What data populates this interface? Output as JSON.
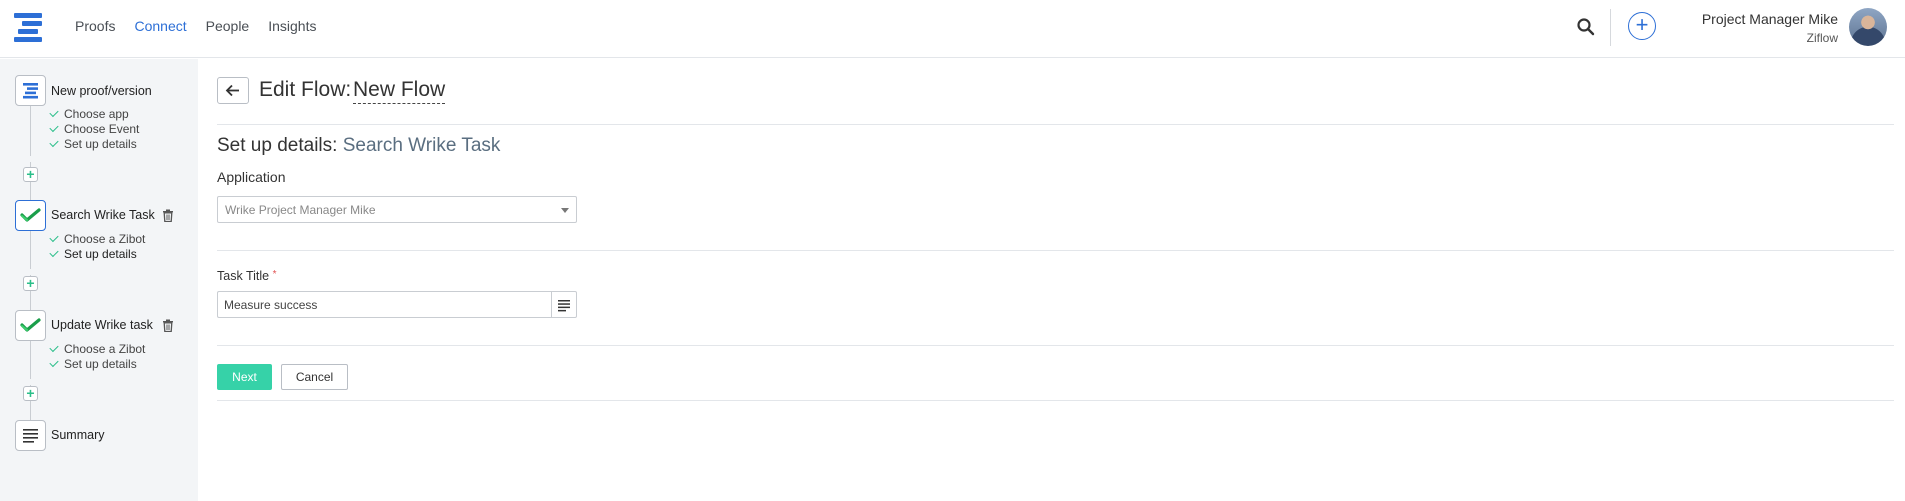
{
  "nav": {
    "items": [
      {
        "label": "Proofs"
      },
      {
        "label": "Connect",
        "active": true
      },
      {
        "label": "People"
      },
      {
        "label": "Insights"
      }
    ]
  },
  "header": {
    "search_icon": "search-icon",
    "add_icon": "plus-circle-icon",
    "user_name": "Project Manager Mike",
    "user_org": "Ziflow"
  },
  "sidebar": {
    "steps": [
      {
        "title": "New proof/version",
        "icon": "ziflow-logo-icon",
        "subs": [
          "Choose app",
          "Choose Event",
          "Set up details"
        ]
      },
      {
        "title": "Search Wrike Task",
        "icon": "wrike-check-icon",
        "subs": [
          "Choose a Zibot",
          "Set up details"
        ],
        "active": true
      },
      {
        "title": "Update Wrike task",
        "icon": "wrike-check-icon",
        "subs": [
          "Choose a Zibot",
          "Set up details"
        ]
      },
      {
        "title": "Summary",
        "icon": "list-lines-icon"
      }
    ]
  },
  "main": {
    "edit_flow_label": "Edit Flow:",
    "flow_name": "New Flow",
    "setup_prefix": "Set up details:",
    "setup_step": "Search Wrike Task",
    "application_label": "Application",
    "application_value": "Wrike Project Manager Mike",
    "task_title_label": "Task Title",
    "task_title_required": "*",
    "task_title_value": "Measure success",
    "next_label": "Next",
    "cancel_label": "Cancel"
  },
  "colors": {
    "accent": "#2d6fd6",
    "primary_button": "#36d2a8",
    "check_green": "#2bbf8a",
    "sidebar_bg": "#f3f5f7"
  }
}
